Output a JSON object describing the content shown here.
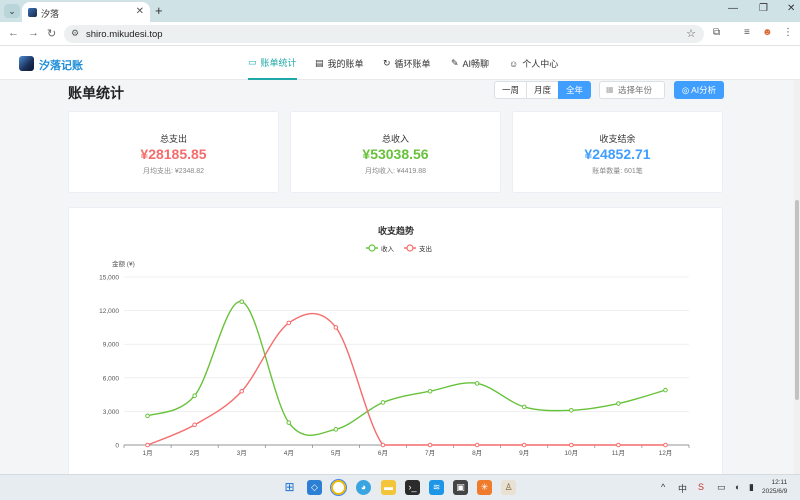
{
  "browser": {
    "tab_title": "汐落",
    "url": "shiro.mikudesi.top"
  },
  "app": {
    "brand": "汐落记账",
    "nav": [
      {
        "label": "账单统计",
        "icon": "monitor-icon",
        "active": true
      },
      {
        "label": "我的账单",
        "icon": "document-icon",
        "active": false
      },
      {
        "label": "循环账单",
        "icon": "refresh-icon",
        "active": false
      },
      {
        "label": "AI畅聊",
        "icon": "pen-icon",
        "active": false
      },
      {
        "label": "个人中心",
        "icon": "user-icon",
        "active": false
      }
    ]
  },
  "page": {
    "title": "账单统计",
    "periods": [
      "一周",
      "月度",
      "全年"
    ],
    "active_period": "全年",
    "year_placeholder": "选择年份",
    "ai_button": "AI分析"
  },
  "cards": [
    {
      "label": "总支出",
      "value": "¥28185.85",
      "sub": "月均支出: ¥2348.82",
      "color": "#f56c6c"
    },
    {
      "label": "总收入",
      "value": "¥53038.56",
      "sub": "月均收入: ¥4419.88",
      "color": "#67c23a"
    },
    {
      "label": "收支结余",
      "value": "¥24852.71",
      "sub": "账单数量: 601笔",
      "color": "#409eff"
    }
  ],
  "chart_data": {
    "type": "line",
    "title": "收支趋势",
    "ylabel": "金额 (¥)",
    "categories": [
      "1月",
      "2月",
      "3月",
      "4月",
      "5月",
      "6月",
      "7月",
      "8月",
      "9月",
      "10月",
      "11月",
      "12月"
    ],
    "ylim": [
      0,
      15000
    ],
    "yticks": [
      "0",
      "3,000",
      "6,000",
      "9,000",
      "12,000",
      "15,000"
    ],
    "legend_position": "top",
    "series": [
      {
        "name": "收入",
        "color": "#67c23a",
        "values": [
          2600,
          4400,
          12800,
          2000,
          1400,
          3800,
          4800,
          5500,
          3400,
          3100,
          3700,
          4900
        ]
      },
      {
        "name": "支出",
        "color": "#f56c6c",
        "values": [
          0,
          1800,
          4800,
          10900,
          10500,
          0,
          0,
          0,
          0,
          0,
          0,
          0
        ]
      }
    ]
  },
  "taskbar": {
    "ime": "中",
    "time": "12:11",
    "date": "2025/6/9"
  }
}
